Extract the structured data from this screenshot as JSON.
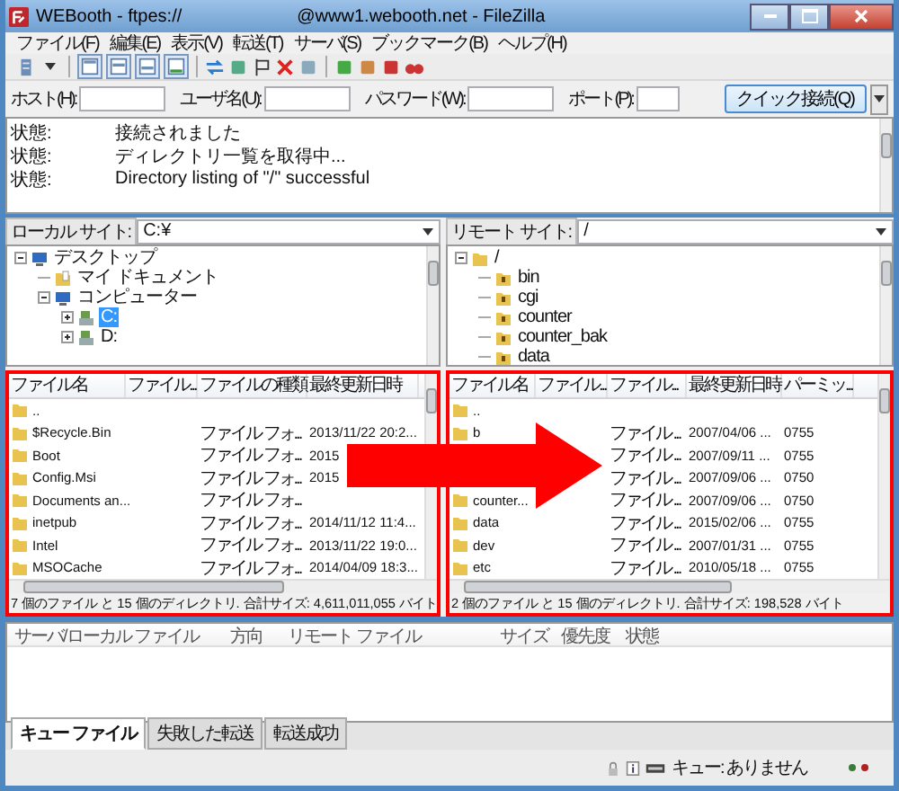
{
  "window": {
    "title_left": "WEBooth - ftpes://",
    "title_right": "@www1.webooth.net - FileZilla"
  },
  "menu": [
    "ファイル(F)",
    "編集(E)",
    "表示(V)",
    "転送(T)",
    "サーバ(S)",
    "ブックマーク(B)",
    "ヘルプ(H)"
  ],
  "toolbar": {
    "toggles": [
      {
        "on": true
      },
      {
        "on": true
      },
      {
        "on": true
      },
      {
        "on": true
      }
    ]
  },
  "quickconnect": {
    "fields": [
      {
        "label": "ホスト(H):"
      },
      {
        "label": "ユーザ名(U):"
      },
      {
        "label": "パスワード(W):"
      },
      {
        "label": "ポート(P):"
      }
    ],
    "button": "クイック接続(Q)"
  },
  "log": [
    {
      "label": "状態:",
      "message": "接続されました"
    },
    {
      "label": "状態:",
      "message": "ディレクトリ一覧を取得中..."
    },
    {
      "label": "状態:",
      "message": "Directory listing of \"/\" successful"
    }
  ],
  "local": {
    "site_label": "ローカル サイト:",
    "path": "C:¥",
    "tree": [
      {
        "label": "デスクトップ",
        "kind": "desktop",
        "expanded": true,
        "children": [
          {
            "label": "マイ ドキュメント",
            "kind": "documents"
          },
          {
            "label": "コンピューター",
            "kind": "computer",
            "expanded": true,
            "children": [
              {
                "label": "C:",
                "kind": "drive",
                "expanded": false,
                "selected": true
              },
              {
                "label": "D:",
                "kind": "drive",
                "expanded": false,
                "selected": false
              }
            ]
          }
        ]
      }
    ],
    "columns": [
      "ファイル名",
      "ファイル...",
      "ファイルの種類",
      "最終更新日時"
    ],
    "rows": [
      {
        "name": ".."
      },
      {
        "name": "$Recycle.Bin",
        "type": "ファイル フォ...",
        "date": "2013/11/22 20:2..."
      },
      {
        "name": "Boot",
        "type": "ファイル フォ...",
        "date": "2015"
      },
      {
        "name": "Config.Msi",
        "type": "ファイル フォ...",
        "date": "2015"
      },
      {
        "name": "Documents an...",
        "type": "ファイル フォ..."
      },
      {
        "name": "inetpub",
        "type": "ファイル フォ...",
        "date": "2014/11/12 11:4..."
      },
      {
        "name": "Intel",
        "type": "ファイル フォ...",
        "date": "2013/11/22 19:0..."
      },
      {
        "name": "MSOCache",
        "type": "ファイル フォ...",
        "date": "2014/04/09 18:3..."
      }
    ],
    "status": "7 個のファイル と 15 個のディレクトリ. 合計サイズ: 4,611,011,055 バイト"
  },
  "remote": {
    "site_label": "リモート サイト:",
    "path": "/",
    "tree": [
      {
        "label": "/",
        "kind": "folder",
        "expanded": true,
        "children": [
          {
            "label": "bin",
            "kind": "unknown"
          },
          {
            "label": "cgi",
            "kind": "unknown"
          },
          {
            "label": "counter",
            "kind": "unknown"
          },
          {
            "label": "counter_bak",
            "kind": "unknown"
          },
          {
            "label": "data",
            "kind": "unknown"
          }
        ]
      }
    ],
    "columns": [
      "ファイル名",
      "ファイル...",
      "ファイル...",
      "最終更新日時",
      "パーミッ..."
    ],
    "rows": [
      {
        "name": ".."
      },
      {
        "name": "b",
        "type": "ファイル ...",
        "date": "2007/04/06 ...",
        "perm": "0755"
      },
      {
        "type": "ファイル ...",
        "date": "2007/09/11 ...",
        "perm": "0755"
      },
      {
        "type": "ファイル ...",
        "date": "2007/09/06 ...",
        "perm": "0750"
      },
      {
        "name": "counter...",
        "type": "ファイル ...",
        "date": "2007/09/06 ...",
        "perm": "0750"
      },
      {
        "name": "data",
        "type": "ファイル ...",
        "date": "2015/02/06 ...",
        "perm": "0755"
      },
      {
        "name": "dev",
        "type": "ファイル ...",
        "date": "2007/01/31 ...",
        "perm": "0755"
      },
      {
        "name": "etc",
        "type": "ファイル ...",
        "date": "2010/05/18 ...",
        "perm": "0755"
      }
    ],
    "status": "2 個のファイル と 15 個のディレクトリ. 合計サイズ: 198,528 バイト"
  },
  "queue": {
    "columns": [
      "サーバ/ローカル ファイル",
      "方向",
      "リモート ファイル",
      "サイズ",
      "優先度",
      "状態"
    ],
    "tabs": [
      {
        "label": "キュー ファイル",
        "selected": true
      },
      {
        "label": "失敗した転送",
        "selected": false
      },
      {
        "label": "転送成功",
        "selected": false
      }
    ]
  },
  "status_bar": {
    "queue": "キュー: ありません"
  },
  "annotation": {
    "highlight_frames": true,
    "arrow": true
  }
}
